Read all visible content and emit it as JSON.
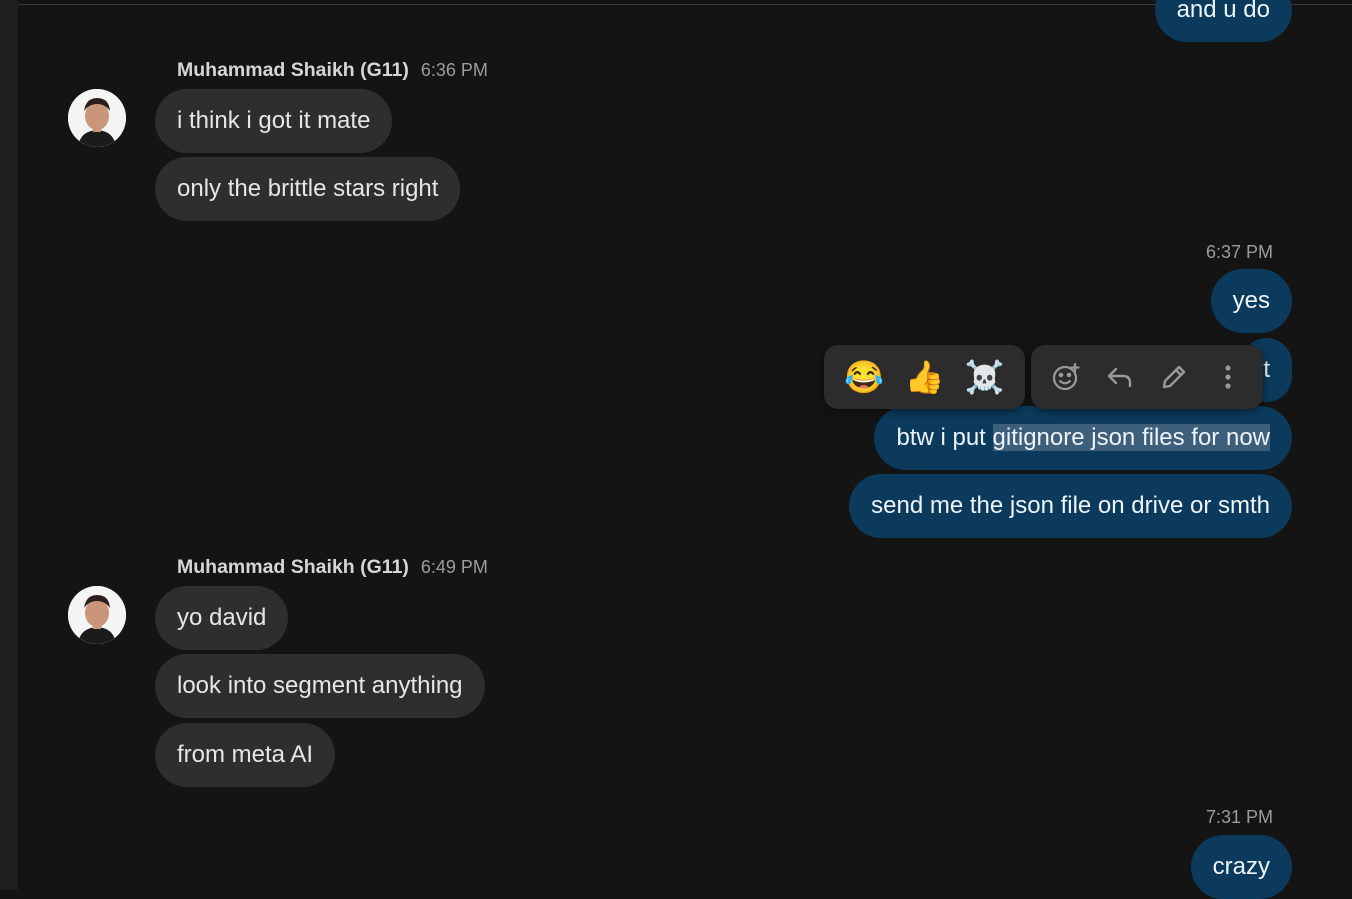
{
  "messages_top": {
    "partial_outgoing": "and u do"
  },
  "group1": {
    "sender": "Muhammad Shaikh (G11)",
    "time": "6:36 PM",
    "messages": [
      "i think i got it mate",
      "only the brittle stars right"
    ]
  },
  "group2": {
    "time": "6:37 PM",
    "messages": [
      "yes",
      "t",
      "btw i put ",
      "gitignore json files for now",
      "send me the json file on drive or smth"
    ]
  },
  "group3": {
    "sender": "Muhammad Shaikh (G11)",
    "time": "6:49 PM",
    "messages": [
      "yo david",
      "look into segment anything",
      "from meta AI"
    ]
  },
  "group4": {
    "time": "7:31 PM",
    "messages": [
      "crazy"
    ]
  },
  "hover_toolbar": {
    "reactions": [
      "😂",
      "👍",
      "☠️"
    ],
    "actions": [
      "add-reaction-icon",
      "reply-icon",
      "edit-icon",
      "more-options-icon"
    ]
  },
  "colors": {
    "background": "#141414",
    "incoming_bubble": "#2e2e2e",
    "outgoing_bubble": "#0b3a5c",
    "selection": "#3d5f7c"
  }
}
